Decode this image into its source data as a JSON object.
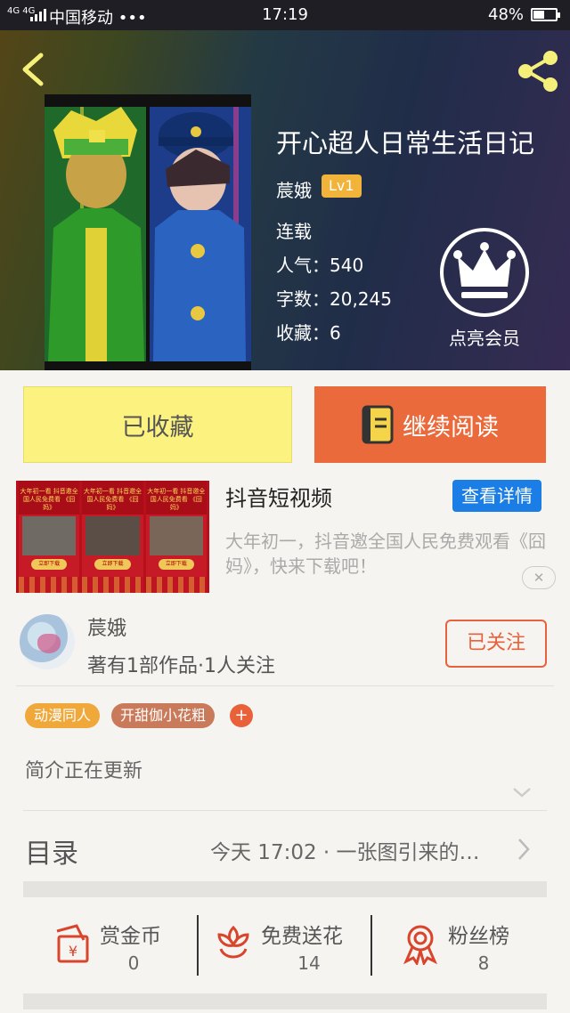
{
  "status_bar": {
    "network": "4G 4G",
    "carrier": "中国移动 •••",
    "time": "17:19",
    "battery": "48%",
    "battery_level": 0.48
  },
  "book": {
    "title": "开心超人日常生活日记",
    "author": "莀娥",
    "level": "Lv1",
    "status": "连载",
    "popularity": "人气：540",
    "word_count": "字数：20,245",
    "favorites": "收藏：6"
  },
  "vip": {
    "label": "点亮会员",
    "icon": "crown-icon"
  },
  "actions": {
    "favorited": "已收藏",
    "continue_reading": "继续阅读"
  },
  "ad": {
    "title": "抖音短视频",
    "detail_button": "查看详情",
    "description": "大年初一，抖音邀全国人民免费观看《囧妈》，快来下载吧！",
    "close": "✕",
    "panel_text": "大年初一看\n抖音邀全国人民免费看\n《囧妈》",
    "panel_button": "立即下载"
  },
  "author_card": {
    "name": "莀娥",
    "stats": "著有1部作品·1人关注",
    "follow_button": "已关注"
  },
  "tags": [
    {
      "label": "动漫同人",
      "color": "#f0a83a"
    },
    {
      "label": "开甜伽小花粗",
      "color": "#c97a5a"
    }
  ],
  "tag_add": "+",
  "intro": "简介正在更新",
  "toc": {
    "label": "目录",
    "latest": "今天 17:02 · 一张图引来的…"
  },
  "stats": [
    {
      "label": "赏金币",
      "value": "0",
      "icon": "coin-envelope-icon"
    },
    {
      "label": "免费送花",
      "value": "14",
      "icon": "flower-icon"
    },
    {
      "label": "粉丝榜",
      "value": "8",
      "icon": "ribbon-medal-icon"
    }
  ],
  "colors": {
    "accent": "#ea6a3c",
    "favorite_bg": "#fbf27f",
    "ad_button": "#1a7ee6",
    "icon_red": "#d8442c"
  }
}
